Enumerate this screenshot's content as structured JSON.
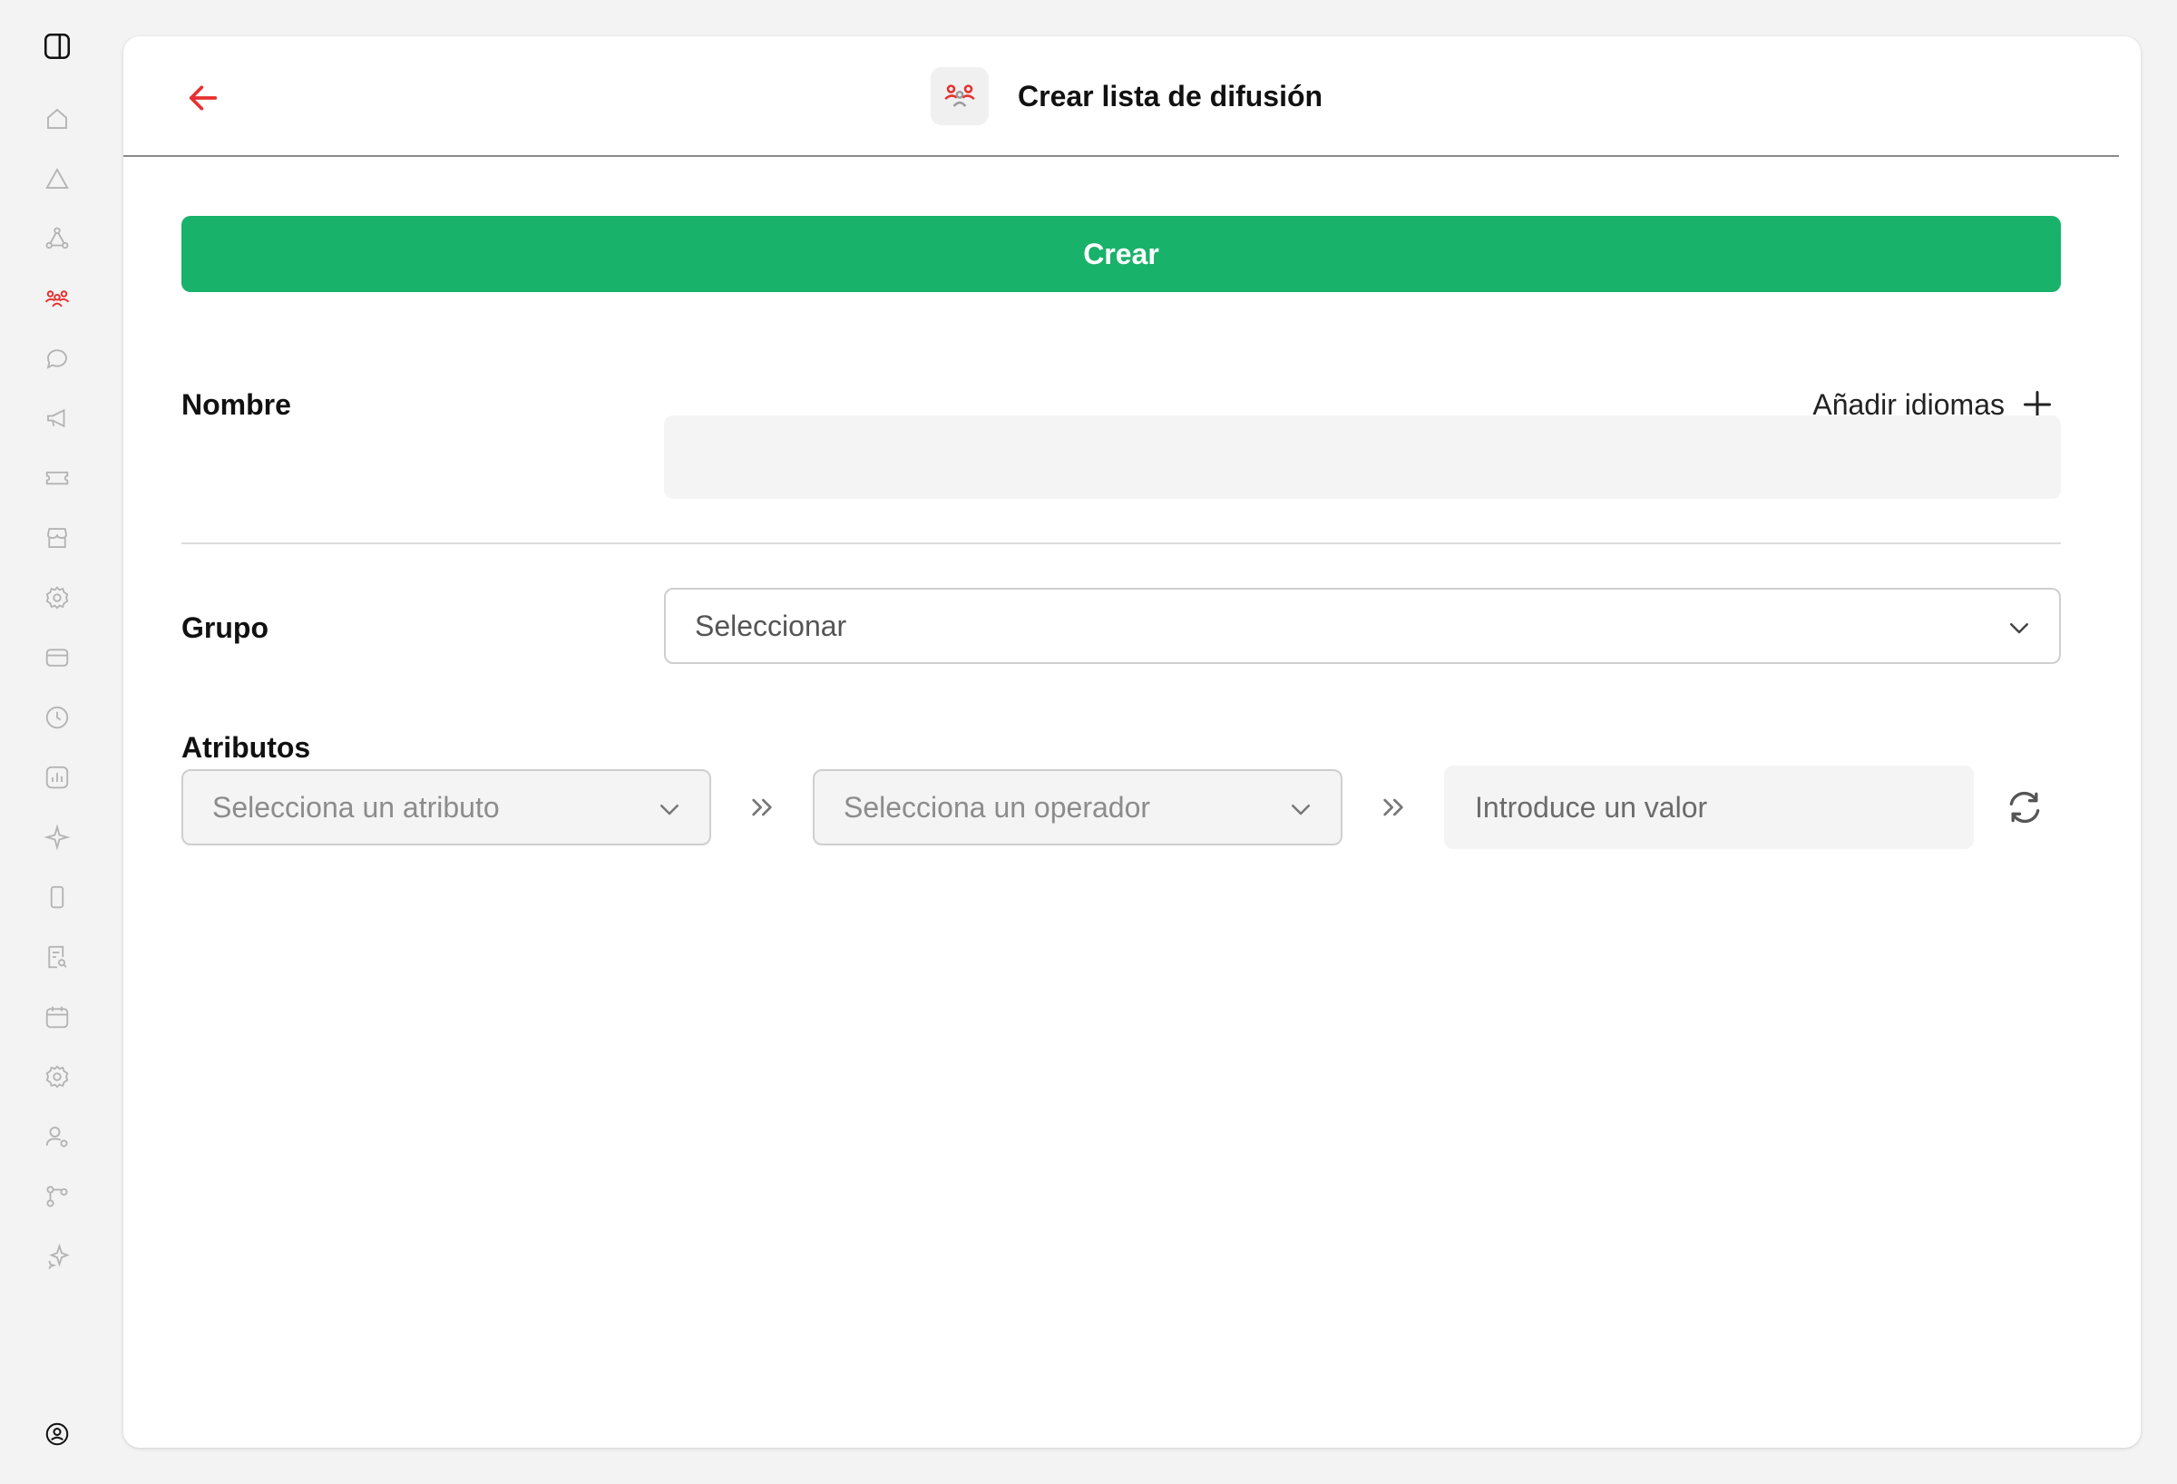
{
  "colors": {
    "accent_red": "#e63030",
    "create_green": "#19b26b",
    "sidebar_icon": "#b4b4b4",
    "sidebar_active": "#e63030"
  },
  "sidebar": {
    "items": [
      {
        "icon": "panel-toggle-icon"
      },
      {
        "icon": "home-icon"
      },
      {
        "icon": "alert-triangle-icon"
      },
      {
        "icon": "network-icon"
      },
      {
        "icon": "users-icon",
        "active": true
      },
      {
        "icon": "chat-bubble-icon"
      },
      {
        "icon": "megaphone-icon"
      },
      {
        "icon": "ticket-icon"
      },
      {
        "icon": "store-icon"
      },
      {
        "icon": "settings-gear-icon"
      },
      {
        "icon": "card-icon"
      },
      {
        "icon": "clock-icon"
      },
      {
        "icon": "analytics-icon"
      },
      {
        "icon": "sparkle-icon"
      },
      {
        "icon": "mobile-icon"
      },
      {
        "icon": "document-search-icon"
      },
      {
        "icon": "calendar-icon"
      },
      {
        "icon": "settings-gear-icon"
      },
      {
        "icon": "user-settings-icon"
      },
      {
        "icon": "flow-icon"
      },
      {
        "icon": "sparkle-icon"
      },
      {
        "icon": "profile-icon"
      }
    ]
  },
  "header": {
    "title": "Crear lista de difusión",
    "back_icon": "arrow-left-icon",
    "title_icon": "users-icon"
  },
  "actions": {
    "create_label": "Crear"
  },
  "form": {
    "nombre": {
      "label": "Nombre",
      "add_languages": "Añadir idiomas",
      "value": "",
      "placeholder": ""
    },
    "grupo": {
      "label": "Grupo",
      "selected": "Seleccionar"
    },
    "atributos": {
      "label": "Atributos",
      "attribute_placeholder": "Selecciona un atributo",
      "operator_placeholder": "Selecciona un operador",
      "value_placeholder": "Introduce un valor"
    }
  }
}
